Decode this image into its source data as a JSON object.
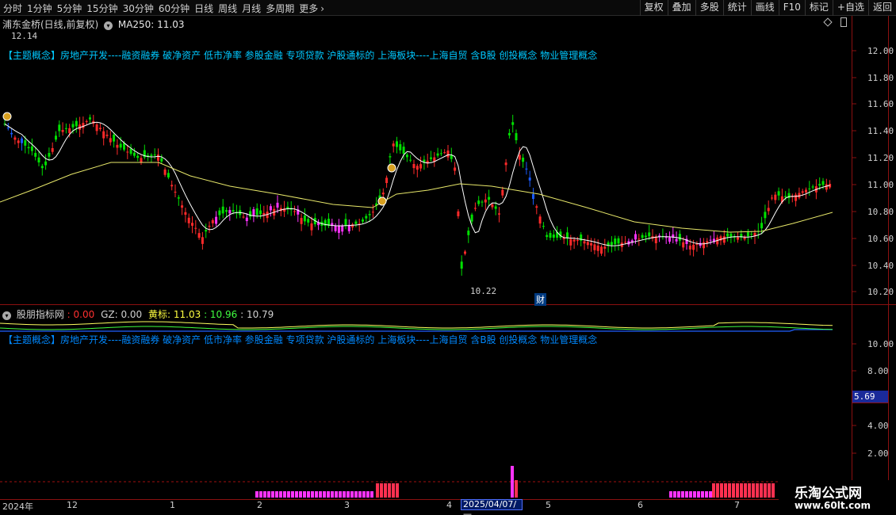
{
  "toolbar": {
    "periods": [
      "分时",
      "1分钟",
      "5分钟",
      "15分钟",
      "30分钟",
      "60分钟",
      "日线",
      "周线",
      "月线",
      "多周期",
      "更多"
    ],
    "buttons": [
      "复权",
      "叠加",
      "多股",
      "统计",
      "画线",
      "F10",
      "标记",
      "+自选",
      "返回"
    ]
  },
  "main": {
    "stock_title": "浦东金桥(日线,前复权)",
    "ma_label": "MA250: 11.03",
    "concepts": "【主题概念】房地产开发----融资融券 破净资产 低市净率 参股金融 专项贷款 沪股通标的 上海板块----上海自贸 含B股 创投概念 物业管理概念",
    "high_label": "12.14",
    "low_label": "10.22",
    "cai_badge": "财",
    "y_ticks": [
      "12.00",
      "11.80",
      "11.60",
      "11.40",
      "11.20",
      "11.00",
      "10.80",
      "10.60",
      "10.40",
      "10.20"
    ]
  },
  "sub": {
    "indicator_name": "股朋指标网",
    "v1": ": 0.00",
    "gz": "GZ: 0.00",
    "huangbiao": "黄标: 11.03",
    "v4": ": 10.96",
    "v5": ": 10.79",
    "concepts": "【主题概念】房地产开发----融资融券 破净资产 低市净率 参股金融 专项贷款 沪股通标的 上海板块----上海自贸 含B股 创投概念 物业管理概念",
    "y_ticks": [
      "10.00",
      "8.00",
      "4.00",
      "2.00"
    ],
    "current_value": "5.69"
  },
  "xaxis": {
    "labels": [
      "2024年",
      "12",
      "1",
      "2",
      "3",
      "4",
      "5",
      "6",
      "7"
    ],
    "selected_date": "2025/04/07/—"
  },
  "watermark": {
    "line1": "乐淘公式网",
    "line2": "www.60lt.com"
  },
  "colors": {
    "up": "#ff2a2a",
    "down": "#00e000",
    "magenta": "#ff33ff",
    "blue": "#1a5cff",
    "ma_fast": "#ffffff",
    "ma_slow": "#e8e86a",
    "frame": "#8b1010"
  }
}
